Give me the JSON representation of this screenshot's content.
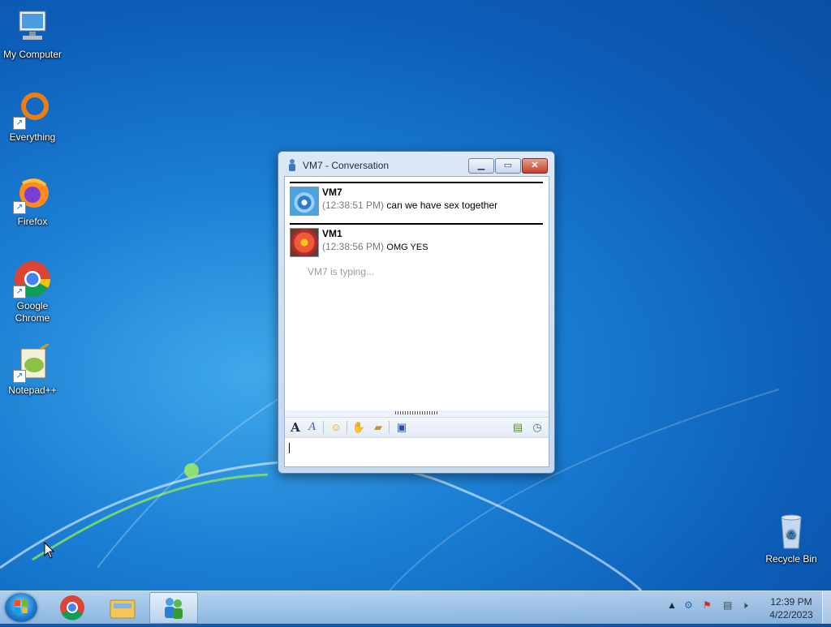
{
  "desktop": {
    "icons": [
      {
        "label": "My Computer"
      },
      {
        "label": "Everything"
      },
      {
        "label": "Firefox"
      },
      {
        "label": "Google Chrome"
      },
      {
        "label": "Notepad++"
      },
      {
        "label": "Recycle Bin"
      }
    ]
  },
  "window": {
    "title": "VM7 - Conversation",
    "messages": [
      {
        "name": "VM7",
        "time": "(12:38:51 PM)",
        "text": "can we have sex together"
      },
      {
        "name": "VM1",
        "time": "(12:38:56 PM)",
        "text": "OMG YES"
      }
    ],
    "typing": "VM7 is typing...",
    "input_value": ""
  },
  "taskbar": {
    "clock_time": "12:39 PM",
    "clock_date": "4/22/2023",
    "tray_arrow": "▲"
  },
  "colors": {
    "desktop_blue": "#1b7fd4",
    "window_frame": "#c5d8ee",
    "close_red": "#c4402a"
  }
}
